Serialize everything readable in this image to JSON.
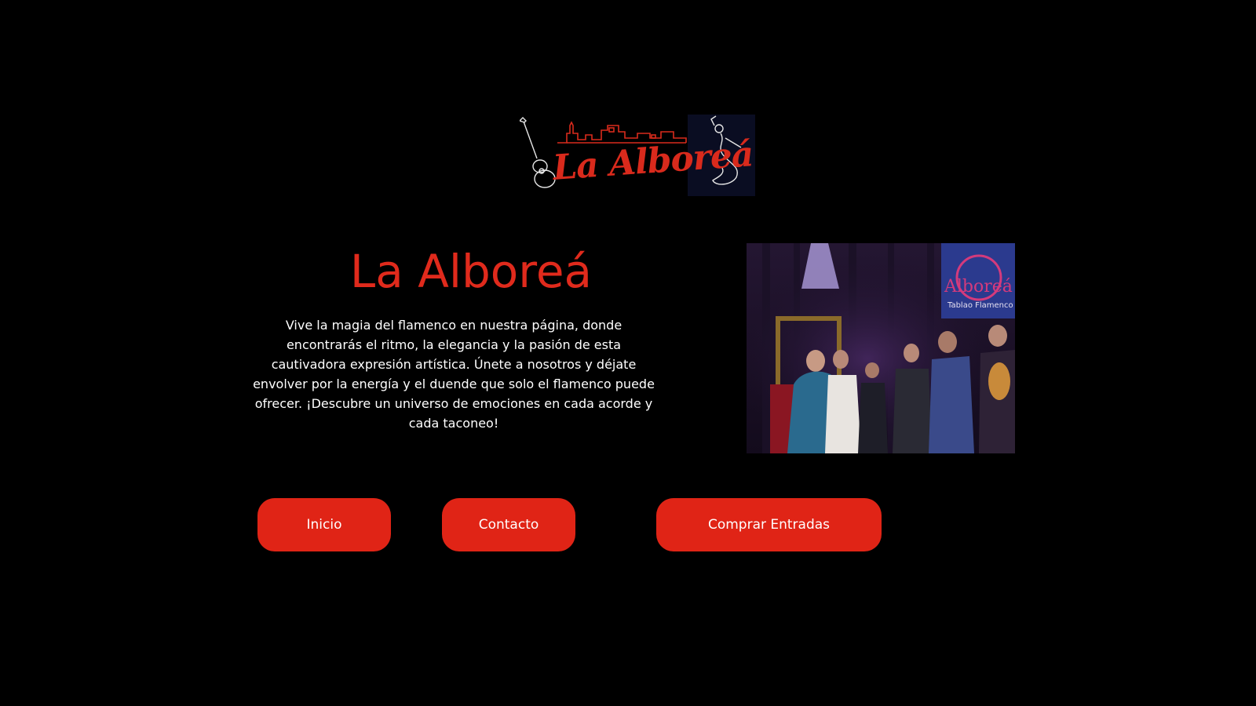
{
  "logo": {
    "text": "La Alboreá",
    "icon": "flamenco-logo-icon"
  },
  "hero": {
    "title": "La Alboreá",
    "description": "Vive la magia del flamenco en nuestra página, donde encontrarás el ritmo, la elegancia y la pasión de esta cautivadora expresión artística. Únete a nosotros y déjate envolver por la energía y el duende que solo el flamenco puede ofrecer. ¡Descubre un universo de emociones en cada acorde y cada taconeo!"
  },
  "photo": {
    "sign_text": "Alboreá",
    "sign_subtext": "Tablao Flamenco"
  },
  "nav": {
    "inicio": "Inicio",
    "contacto": "Contacto",
    "comprar": "Comprar Entradas"
  },
  "colors": {
    "background": "#000000",
    "accent": "#e02416",
    "title": "#e02a1c",
    "text": "#ffffff"
  }
}
